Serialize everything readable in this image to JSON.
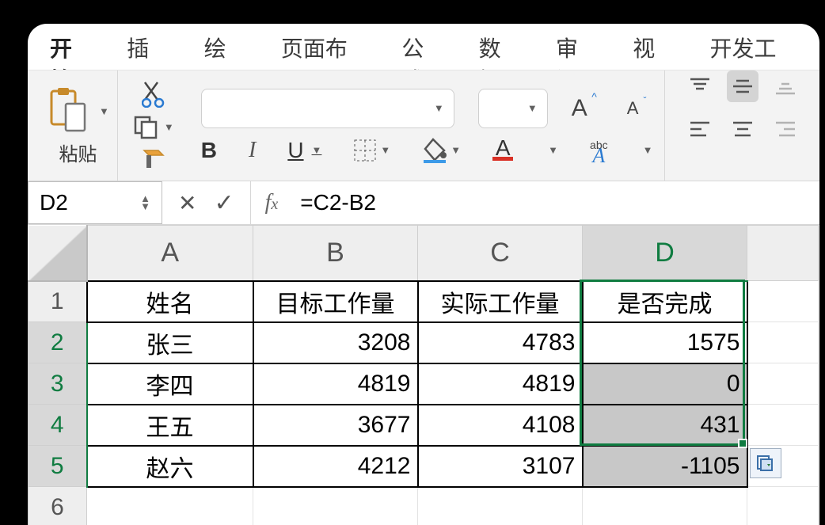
{
  "tabs": [
    "开始",
    "插入",
    "绘图",
    "页面布局",
    "公式",
    "数据",
    "审阅",
    "视图",
    "开发工具"
  ],
  "active_tab_index": 0,
  "ribbon": {
    "paste_label": "粘贴",
    "font_name": "",
    "font_size": "",
    "phonetic_label": "abc"
  },
  "namebox": "D2",
  "formula": "=C2-B2",
  "columns": [
    "A",
    "B",
    "C",
    "D"
  ],
  "active_col_index": 3,
  "rows_visible": [
    1,
    2,
    3,
    4,
    5,
    6
  ],
  "active_rows": [
    2,
    3,
    4,
    5
  ],
  "chart_data": {
    "type": "table",
    "headers": [
      "姓名",
      "目标工作量",
      "实际工作量",
      "是否完成"
    ],
    "rows": [
      {
        "name": "张三",
        "target": 3208,
        "actual": 4783,
        "done": 1575
      },
      {
        "name": "李四",
        "target": 4819,
        "actual": 4819,
        "done": 0
      },
      {
        "name": "王五",
        "target": 3677,
        "actual": 4108,
        "done": 431
      },
      {
        "name": "赵六",
        "target": 4212,
        "actual": 3107,
        "done": -1105
      }
    ]
  },
  "selection": {
    "ref": "D2:D5",
    "active": "D2"
  }
}
